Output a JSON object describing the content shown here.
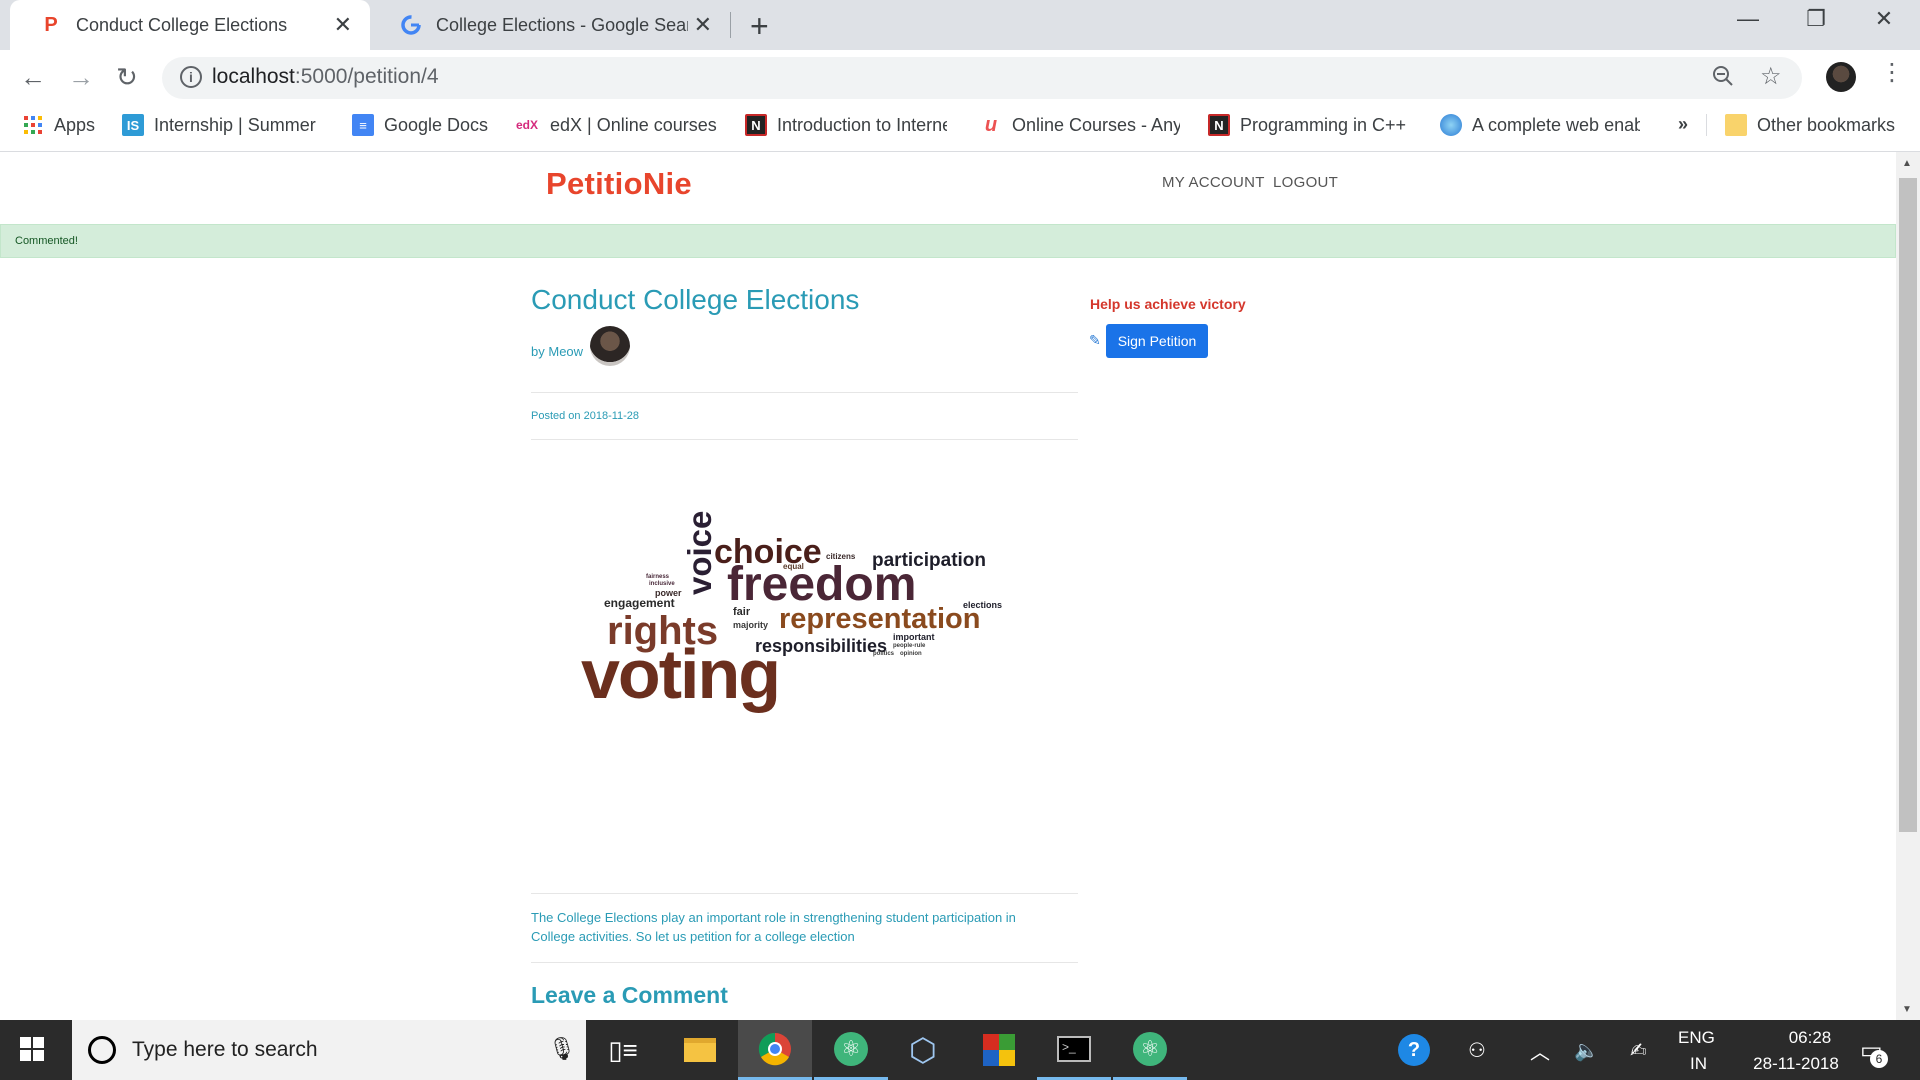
{
  "browser": {
    "tabs": [
      {
        "title": "Conduct College Elections",
        "favicon": "P"
      },
      {
        "title": "College Elections - Google Search",
        "favicon": "G"
      }
    ],
    "new_tab": "+",
    "url_host": "localhost",
    "url_path": ":5000/petition/4",
    "bookmarks": [
      {
        "label": "Apps",
        "icon": "apps-icon"
      },
      {
        "label": "Internship | Summer Internship",
        "icon": "internshala-icon"
      },
      {
        "label": "Google Docs",
        "icon": "docs-icon"
      },
      {
        "label": "edX | Online courses",
        "icon": "edx-icon"
      },
      {
        "label": "Introduction to Internet",
        "icon": "notion-icon"
      },
      {
        "label": "Online Courses - Anytime",
        "icon": "udemy-icon"
      },
      {
        "label": "Programming in C++",
        "icon": "notion-icon"
      },
      {
        "label": "A complete web enabled",
        "icon": "globe-icon"
      },
      {
        "label": "»",
        "icon": "chevron-icon"
      },
      {
        "label": "Other bookmarks",
        "icon": "folder-icon"
      }
    ]
  },
  "site": {
    "logo": "PetitioNie",
    "nav": {
      "account": "MY ACCOUNT",
      "logout": "LOGOUT"
    },
    "flash": "Commented!"
  },
  "petition": {
    "title": "Conduct College Elections",
    "by_prefix": "by",
    "author": "Meow",
    "posted": "Posted on 2018-11-28",
    "description": "The College Elections play an important role in strengthening student participation in College activities. So let us petition for a college election",
    "leave_comment": "Leave a Comment",
    "help_text": "Help us achieve victory",
    "sign_button": "Sign Petition"
  },
  "wordcloud": {
    "words": [
      "voice",
      "choice",
      "freedom",
      "participation",
      "citizens",
      "equal",
      "engagement",
      "rights",
      "fair",
      "majority",
      "representation",
      "responsibilities",
      "elections",
      "important",
      "voting",
      "power",
      "inclusive",
      "fairness",
      "people-rule",
      "politics",
      "opinion"
    ]
  },
  "taskbar": {
    "search_placeholder": "Type here to search",
    "lang_top": "ENG",
    "lang_bottom": "IN",
    "time": "06:28",
    "date": "28-11-2018",
    "notifications": "6"
  },
  "colors": {
    "accent": "#2a9bb5",
    "logo": "#e8452c",
    "help": "#d4372c",
    "button": "#1a73e8",
    "flash_bg": "#d4edda"
  }
}
